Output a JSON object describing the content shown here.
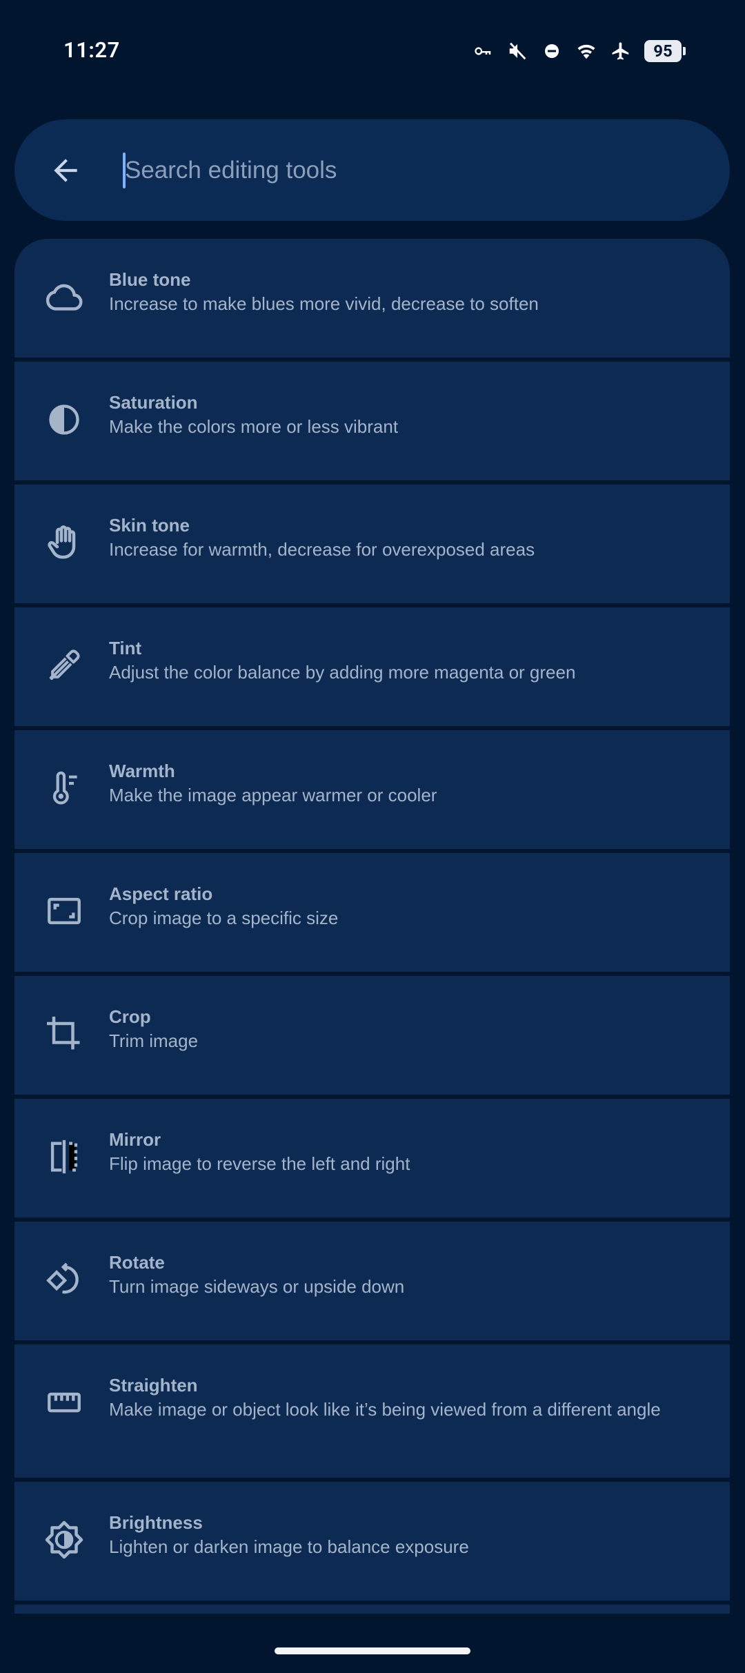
{
  "status_bar": {
    "time": "11:27",
    "battery": "95",
    "icons": [
      "vpn-key-icon",
      "mute-icon",
      "do-not-disturb-icon",
      "wifi-icon",
      "airplane-icon",
      "battery-icon"
    ]
  },
  "search": {
    "placeholder": "Search editing tools",
    "value": ""
  },
  "tools": [
    {
      "title": "Blue tone",
      "description": "Increase to make blues more vivid, decrease to soften",
      "icon": "cloud-icon"
    },
    {
      "title": "Saturation",
      "description": "Make the colors more or less vibrant",
      "icon": "contrast-icon"
    },
    {
      "title": "Skin tone",
      "description": "Increase for warmth, decrease for overexposed areas",
      "icon": "hand-icon"
    },
    {
      "title": "Tint",
      "description": "Adjust the color balance by adding more magenta or green",
      "icon": "eyedropper-icon"
    },
    {
      "title": "Warmth",
      "description": "Make the image appear warmer or cooler",
      "icon": "thermometer-icon"
    },
    {
      "title": "Aspect ratio",
      "description": "Crop image to a specific size",
      "icon": "aspect-ratio-icon"
    },
    {
      "title": "Crop",
      "description": "Trim image",
      "icon": "crop-icon"
    },
    {
      "title": "Mirror",
      "description": "Flip image to reverse the left and right",
      "icon": "mirror-icon"
    },
    {
      "title": "Rotate",
      "description": "Turn image sideways or upside down",
      "icon": "rotate-icon"
    },
    {
      "title": "Straighten",
      "description": "Make image or object look like it’s being viewed from a different angle",
      "icon": "ruler-icon"
    },
    {
      "title": "Brightness",
      "description": "Lighten or darken image to balance exposure",
      "icon": "brightness-icon"
    }
  ],
  "colors": {
    "background": "#02152f",
    "surface": "#0d2a52",
    "search_surface": "#0b2b55",
    "text": "#a4b4ca",
    "accent": "#7fb0ff"
  }
}
